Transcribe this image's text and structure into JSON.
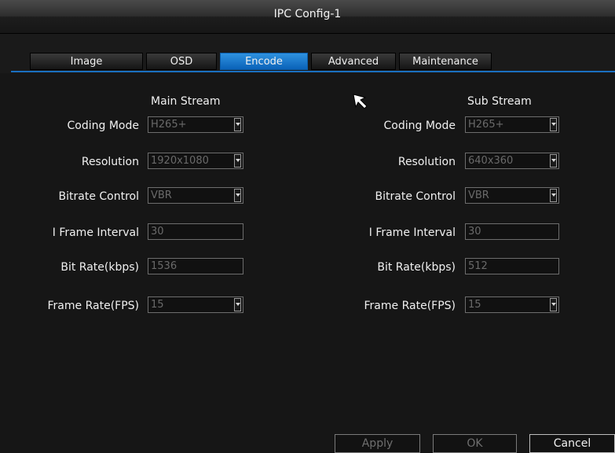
{
  "window": {
    "title": "IPC Config-1"
  },
  "tabs": [
    {
      "label": "Image",
      "active": false
    },
    {
      "label": "OSD",
      "active": false
    },
    {
      "label": "Encode",
      "active": true
    },
    {
      "label": "Advanced",
      "active": false
    },
    {
      "label": "Maintenance",
      "active": false
    }
  ],
  "main_stream": {
    "header": "Main Stream",
    "coding_mode": {
      "label": "Coding Mode",
      "value": "H265+"
    },
    "resolution": {
      "label": "Resolution",
      "value": "1920x1080"
    },
    "bitrate_control": {
      "label": "Bitrate Control",
      "value": "VBR"
    },
    "i_frame_interval": {
      "label": "I Frame Interval",
      "value": "30"
    },
    "bit_rate": {
      "label": "Bit Rate(kbps)",
      "value": "1536"
    },
    "frame_rate": {
      "label": "Frame Rate(FPS)",
      "value": "15"
    }
  },
  "sub_stream": {
    "header": "Sub Stream",
    "coding_mode": {
      "label": "Coding Mode",
      "value": "H265+"
    },
    "resolution": {
      "label": "Resolution",
      "value": "640x360"
    },
    "bitrate_control": {
      "label": "Bitrate Control",
      "value": "VBR"
    },
    "i_frame_interval": {
      "label": "I Frame Interval",
      "value": "30"
    },
    "bit_rate": {
      "label": "Bit Rate(kbps)",
      "value": "512"
    },
    "frame_rate": {
      "label": "Frame Rate(FPS)",
      "value": "15"
    }
  },
  "buttons": {
    "apply": "Apply",
    "ok": "OK",
    "cancel": "Cancel"
  },
  "colors": {
    "accent": "#1a6fc0",
    "active_tab": "#1a7ad0"
  }
}
